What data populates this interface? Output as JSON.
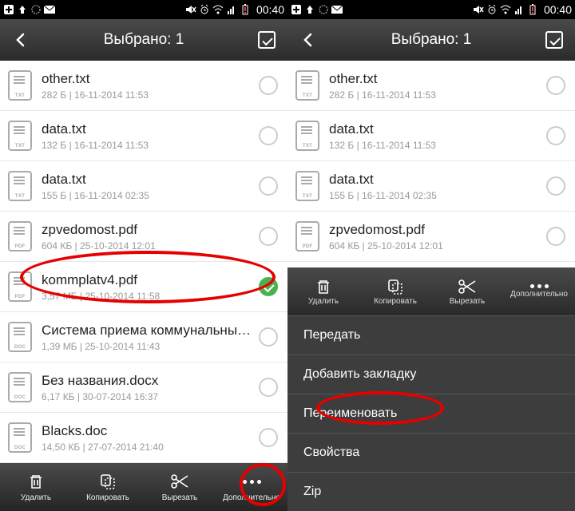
{
  "status": {
    "clock": "00:40"
  },
  "header": {
    "title": "Выбрано: 1"
  },
  "files": [
    {
      "name": "other.txt",
      "meta": "282 Б | 16-11-2014 11:53",
      "ext": "TXT",
      "selected": false
    },
    {
      "name": "data.txt",
      "meta": "132 Б | 16-11-2014 11:53",
      "ext": "TXT",
      "selected": false
    },
    {
      "name": "data.txt",
      "meta": "155 Б | 16-11-2014 02:35",
      "ext": "TXT",
      "selected": false
    },
    {
      "name": "zpvedomost.pdf",
      "meta": "604 КБ | 25-10-2014 12:01",
      "ext": "PDF",
      "selected": false
    },
    {
      "name": "kommplatv4.pdf",
      "meta": "3,57 МБ | 25-10-2014 11:58",
      "ext": "PDF",
      "selected": true
    },
    {
      "name": "Система приема коммунальных п…",
      "meta": "1,39 МБ | 25-10-2014 11:43",
      "ext": "DOC",
      "selected": false
    },
    {
      "name": "Без названия.docx",
      "meta": "6,17 КБ | 30-07-2014 16:37",
      "ext": "DOC",
      "selected": false
    },
    {
      "name": "Blacks.doc",
      "meta": "14,50 КБ | 27-07-2014 21:40",
      "ext": "DOC",
      "selected": false
    }
  ],
  "files_right": [
    {
      "name": "other.txt",
      "meta": "282 Б | 16-11-2014 11:53",
      "ext": "TXT"
    },
    {
      "name": "data.txt",
      "meta": "132 Б | 16-11-2014 11:53",
      "ext": "TXT"
    },
    {
      "name": "data.txt",
      "meta": "155 Б | 16-11-2014 02:35",
      "ext": "TXT"
    },
    {
      "name": "zpvedomost.pdf",
      "meta": "604 КБ | 25-10-2014 12:01",
      "ext": "PDF"
    }
  ],
  "toolbar": {
    "delete": "Удалить",
    "copy": "Копировать",
    "cut": "Вырезать",
    "more": "Дополнительно"
  },
  "menu": {
    "items": [
      "Передать",
      "Добавить закладку",
      "Переименовать",
      "Свойства",
      "Zip"
    ]
  }
}
